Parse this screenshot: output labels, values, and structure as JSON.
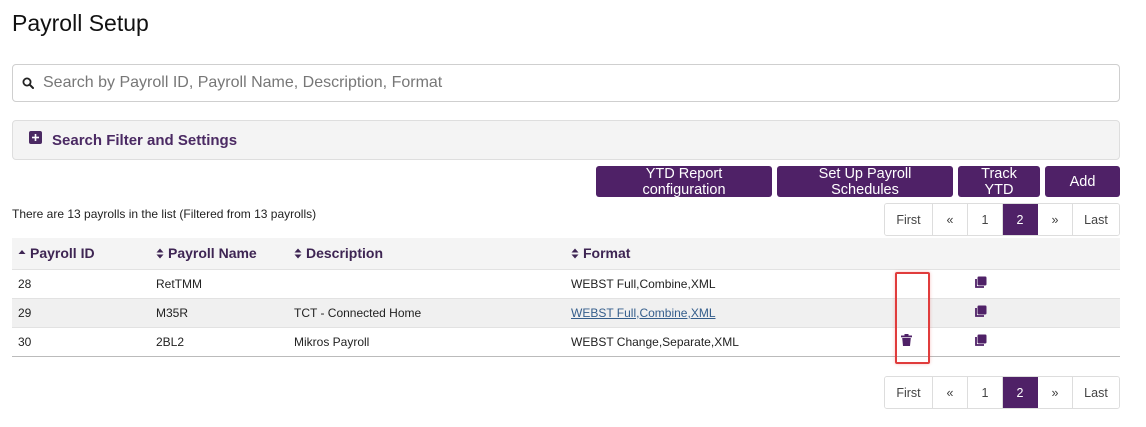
{
  "page": {
    "title": "Payroll Setup"
  },
  "search": {
    "placeholder": "Search by Payroll ID, Payroll Name, Description, Format",
    "value": ""
  },
  "filter_panel": {
    "label": "Search Filter and Settings"
  },
  "actions": {
    "ytd_config": "YTD Report configuration",
    "schedules": "Set Up Payroll Schedules",
    "track_ytd": "Track YTD",
    "add": "Add"
  },
  "summary": {
    "text": "There are 13 payrolls in the list (Filtered from 13 payrolls)"
  },
  "pagination": {
    "first": "First",
    "prev": "«",
    "pages": [
      "1",
      "2"
    ],
    "active_page": "2",
    "next": "»",
    "last": "Last"
  },
  "table": {
    "headers": [
      "Payroll ID",
      "Payroll Name",
      "Description",
      "Format"
    ],
    "rows": [
      {
        "id": "28",
        "name": "RetTMM",
        "description": "",
        "format": "WEBST Full,Combine,XML"
      },
      {
        "id": "29",
        "name": "M35R",
        "description": "TCT - Connected Home",
        "format": "WEBST Full,Combine,XML"
      },
      {
        "id": "30",
        "name": "2BL2",
        "description": "Mikros Payroll",
        "format": "WEBST Change,Separate,XML"
      }
    ]
  },
  "colors": {
    "accent": "#4f2167",
    "highlight": "#e03c3c",
    "link": "#355e8c"
  },
  "icons": {
    "search": "search-icon",
    "expand": "plus-square-icon",
    "sort": "sort-icon",
    "delete": "trash-icon",
    "copy": "copy-icon"
  }
}
